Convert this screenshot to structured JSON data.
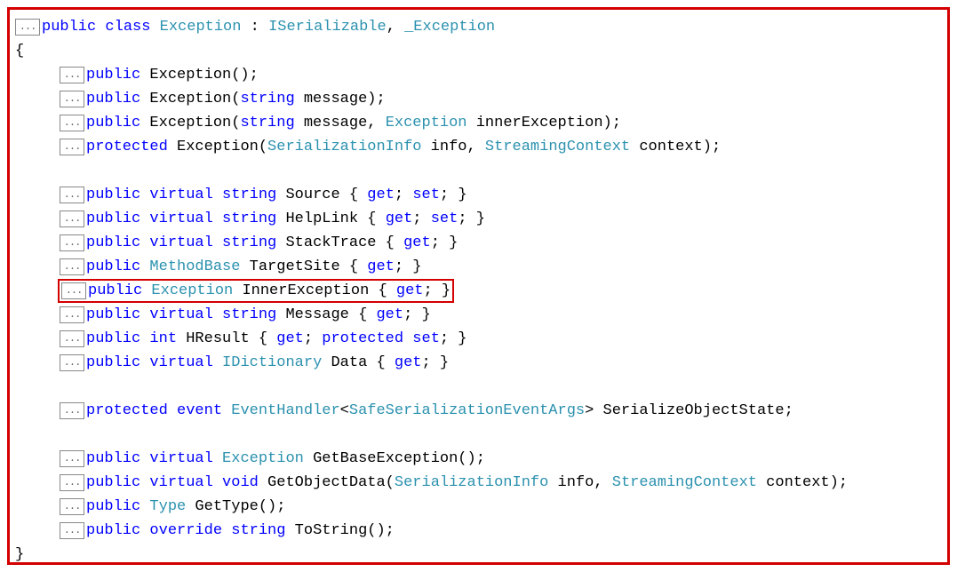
{
  "fold": "...",
  "class_decl": {
    "mod": "public",
    "kw": "class",
    "name": "Exception",
    "colon": " : ",
    "iface1": "ISerializable",
    "comma": ", ",
    "iface2": "_Exception"
  },
  "brace_open": "{",
  "brace_close": "}",
  "ctor1": {
    "mod": "public",
    "name": " Exception();"
  },
  "ctor2": {
    "mod": "public",
    "name1": " Exception(",
    "ptype": "string",
    "name2": " message);"
  },
  "ctor3": {
    "mod": "public",
    "name1": " Exception(",
    "ptype1": "string",
    "mid": " message, ",
    "ptype2": "Exception",
    "name2": " innerException);"
  },
  "ctor4": {
    "mod": "protected",
    "name1": " Exception(",
    "ptype1": "SerializationInfo",
    "mid": " info, ",
    "ptype2": "StreamingContext",
    "name2": " context);"
  },
  "prop_source": {
    "mod": "public",
    "virt": "virtual",
    "rtype": "string",
    "name": " Source { ",
    "get": "get",
    "sep": "; ",
    "set": "set",
    "end": "; }"
  },
  "prop_helplink": {
    "mod": "public",
    "virt": "virtual",
    "rtype": "string",
    "name": " HelpLink { ",
    "get": "get",
    "sep": "; ",
    "set": "set",
    "end": "; }"
  },
  "prop_stacktrace": {
    "mod": "public",
    "virt": "virtual",
    "rtype": "string",
    "name": " StackTrace { ",
    "get": "get",
    "end": "; }"
  },
  "prop_targetsite": {
    "mod": "public",
    "rtype": "MethodBase",
    "name": " TargetSite { ",
    "get": "get",
    "end": "; }"
  },
  "prop_inner": {
    "mod": "public",
    "rtype": "Exception",
    "name": " InnerException { ",
    "get": "get",
    "end": "; }"
  },
  "prop_message": {
    "mod": "public",
    "virt": "virtual",
    "rtype": "string",
    "name": " Message { ",
    "get": "get",
    "end": "; }"
  },
  "prop_hresult": {
    "mod": "public",
    "rtype": "int",
    "name": " HResult { ",
    "get": "get",
    "sep": "; ",
    "prot": "protected",
    "set": "set",
    "end": "; }"
  },
  "prop_data": {
    "mod": "public",
    "virt": "virtual",
    "rtype": "IDictionary",
    "name": " Data { ",
    "get": "get",
    "end": "; }"
  },
  "evt": {
    "mod": "protected",
    "kw": "event",
    "type1": "EventHandler",
    "lt": "<",
    "type2": "SafeSerializationEventArgs",
    "gt": ">",
    "name": " SerializeObjectState;"
  },
  "m_getbase": {
    "mod": "public",
    "virt": "virtual",
    "rtype": "Exception",
    "name": " GetBaseException();"
  },
  "m_getobj": {
    "mod": "public",
    "virt": "virtual",
    "rtype": "void",
    "name1": " GetObjectData(",
    "ptype1": "SerializationInfo",
    "mid": " info, ",
    "ptype2": "StreamingContext",
    "name2": " context);"
  },
  "m_gettype": {
    "mod": "public",
    "rtype": "Type",
    "name": " GetType();"
  },
  "m_tostring": {
    "mod": "public",
    "virt": "override",
    "rtype": "string",
    "name": " ToString();"
  }
}
